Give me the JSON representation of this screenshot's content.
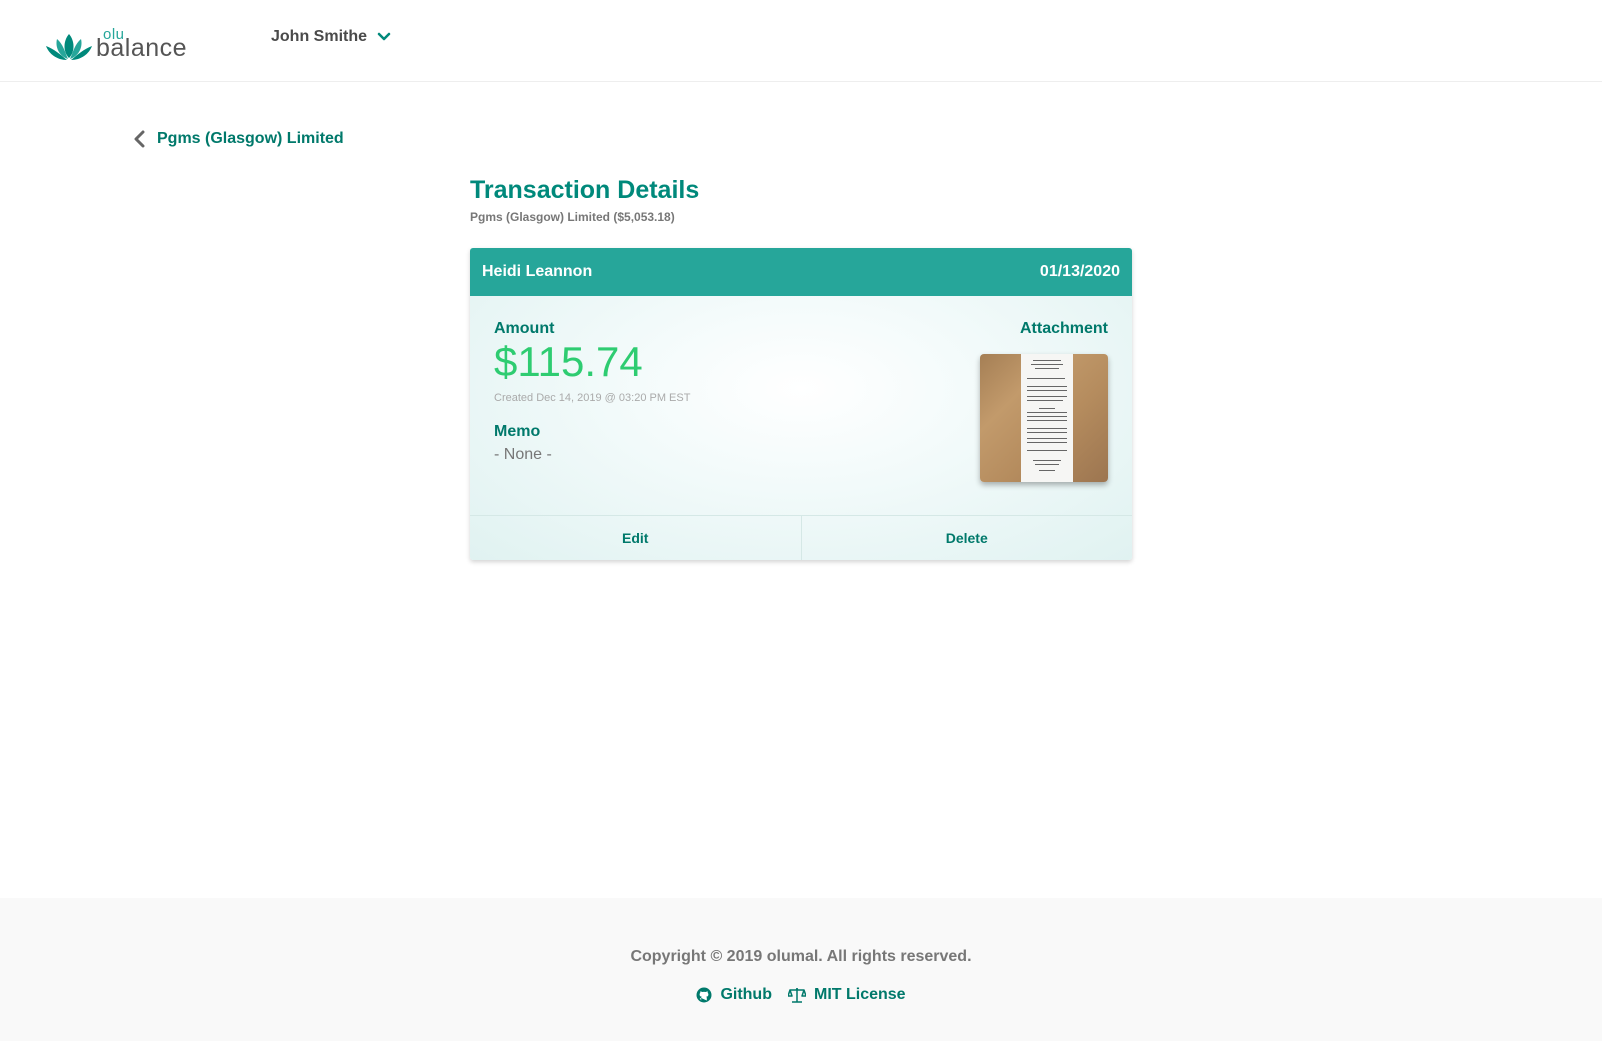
{
  "header": {
    "logo_small": "olu",
    "logo_main": "balance",
    "user_name": "John Smithe"
  },
  "back_link": {
    "label": "Pgms (Glasgow) Limited"
  },
  "page": {
    "title": "Transaction Details",
    "subtitle": "Pgms (Glasgow) Limited ($5,053.18)"
  },
  "transaction": {
    "payee": "Heidi Leannon",
    "date": "01/13/2020",
    "amount_label": "Amount",
    "amount": "$115.74",
    "created": "Created Dec 14, 2019 @ 03:20 PM EST",
    "memo_label": "Memo",
    "memo": "- None -",
    "attachment_label": "Attachment",
    "attachment_icon": "receipt-photo"
  },
  "actions": {
    "edit": "Edit",
    "delete": "Delete"
  },
  "footer": {
    "copyright": "Copyright © 2019 olumal. All rights reserved.",
    "github": "Github",
    "license": "MIT License"
  },
  "colors": {
    "brand": "#26a69a",
    "brand_dark": "#00796b",
    "amount": "#2ecc71"
  }
}
